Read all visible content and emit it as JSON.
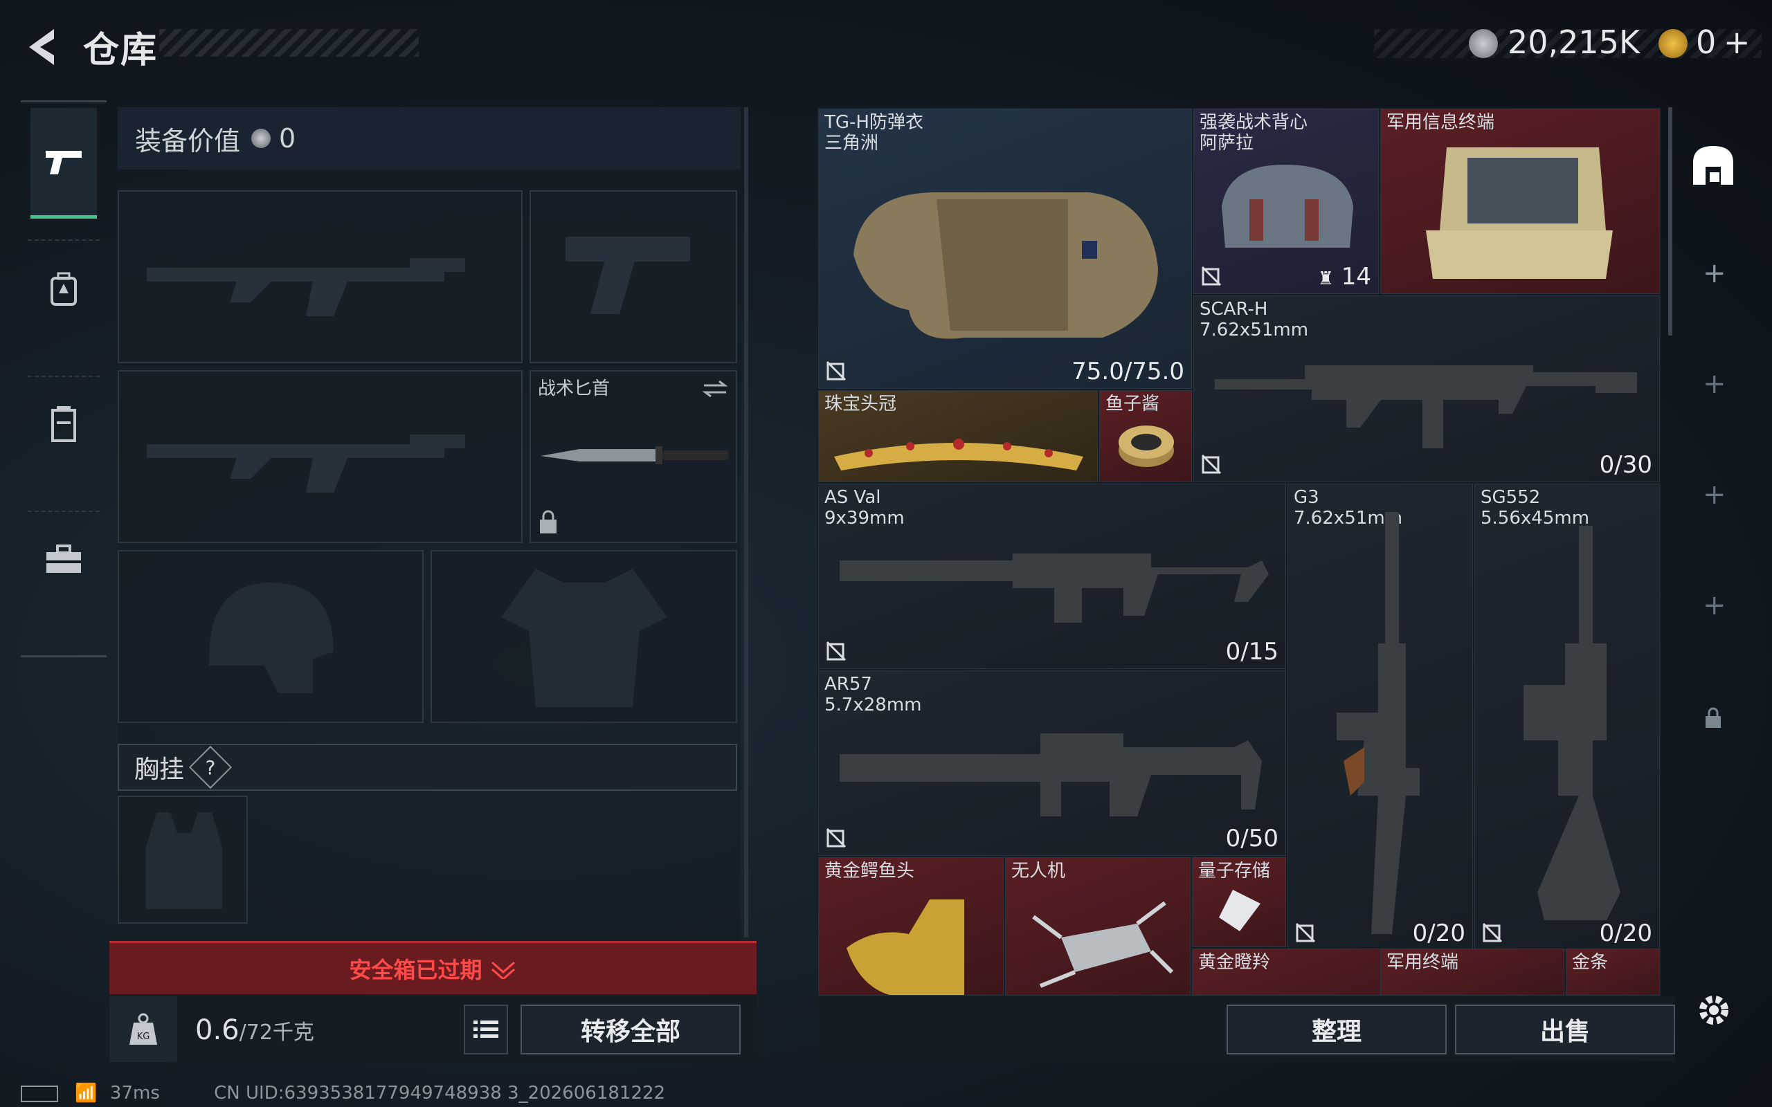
{
  "header": {
    "title": "仓库",
    "currency1": "20,215K",
    "currency2": "0"
  },
  "sidebar": {
    "items": [
      "weapons",
      "backpack",
      "armor-rig",
      "case"
    ]
  },
  "left": {
    "equip_value_label": "装备价值",
    "equip_value": "0",
    "knife_label": "战术匕首",
    "chest_label": "胸挂",
    "chest_help": "?",
    "safe_box": "安全箱已过期",
    "weight_value": "0.6",
    "weight_cap": "/72千克",
    "transfer_all": "转移全部"
  },
  "stash": {
    "items": [
      {
        "id": "tgh",
        "name": "TG-H防弹衣",
        "sub": "三角洲",
        "count": "75.0/75.0",
        "color": "blue"
      },
      {
        "id": "vest",
        "name": "强袭战术背心",
        "sub": "阿萨拉",
        "count": "14",
        "color": "purple"
      },
      {
        "id": "terminal",
        "name": "军用信息终端",
        "sub": "",
        "count": "",
        "color": "red"
      },
      {
        "id": "crown",
        "name": "珠宝头冠",
        "sub": "",
        "count": "",
        "color": "gold"
      },
      {
        "id": "caviar",
        "name": "鱼子酱",
        "sub": "",
        "count": "",
        "color": "red"
      },
      {
        "id": "scarh",
        "name": "SCAR-H",
        "sub": "7.62x51mm",
        "count": "0/30",
        "color": "gray"
      },
      {
        "id": "asval",
        "name": "AS Val",
        "sub": "9x39mm",
        "count": "0/15",
        "color": "gray"
      },
      {
        "id": "g3",
        "name": "G3",
        "sub": "7.62x51mm",
        "count": "0/20",
        "color": "gray"
      },
      {
        "id": "sg552",
        "name": "SG552",
        "sub": "5.56x45mm",
        "count": "0/20",
        "color": "gray"
      },
      {
        "id": "ar57",
        "name": "AR57",
        "sub": "5.7x28mm",
        "count": "0/50",
        "color": "gray"
      },
      {
        "id": "croc",
        "name": "黄金鳄鱼头",
        "sub": "",
        "count": "",
        "color": "red"
      },
      {
        "id": "drone",
        "name": "无人机",
        "sub": "",
        "count": "",
        "color": "red"
      },
      {
        "id": "quantum",
        "name": "量子存储",
        "sub": "",
        "count": "",
        "color": "red"
      },
      {
        "id": "goldeye",
        "name": "黄金瞪羚",
        "sub": "",
        "count": "",
        "color": "red"
      },
      {
        "id": "milterm",
        "name": "军用终端",
        "sub": "",
        "count": "",
        "color": "red"
      },
      {
        "id": "goldbar",
        "name": "金条",
        "sub": "",
        "count": "",
        "color": "red"
      }
    ],
    "sort_btn": "整理",
    "sell_btn": "出售"
  },
  "status": {
    "ping": "37ms",
    "uid": "CN UID:6393538177949748938 3_202606181222"
  }
}
